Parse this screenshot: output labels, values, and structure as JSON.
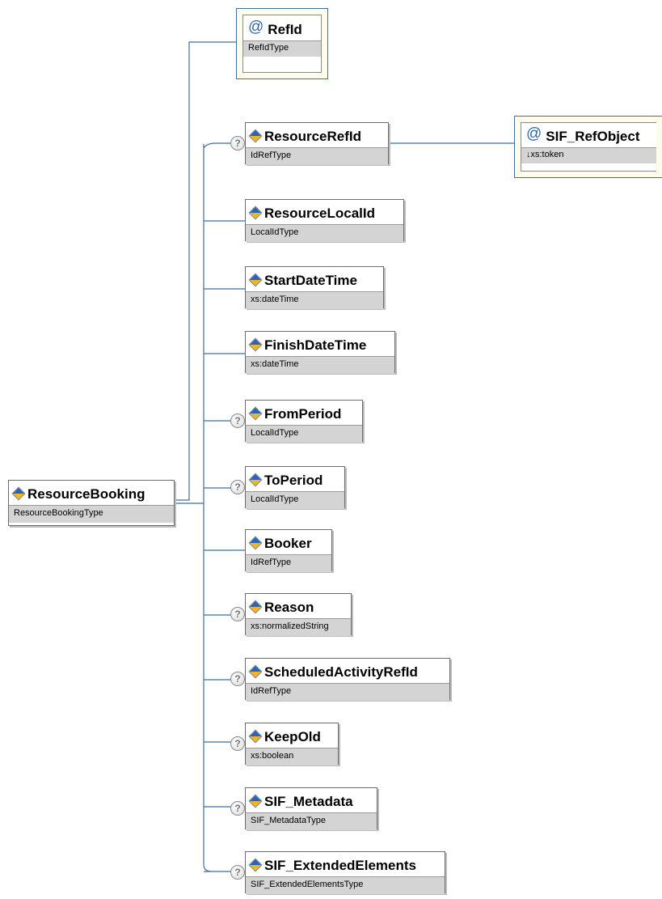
{
  "root": {
    "name": "ResourceBooking",
    "type": "ResourceBookingType"
  },
  "attributes": [
    {
      "name": "RefId",
      "type": "RefIdType"
    }
  ],
  "ref_object": {
    "name": "SIF_RefObject",
    "type": "↓xs:token"
  },
  "children": [
    {
      "name": "ResourceRefId",
      "type": "IdRefType",
      "optional": true
    },
    {
      "name": "ResourceLocalId",
      "type": "LocalIdType",
      "optional": false
    },
    {
      "name": "StartDateTime",
      "type": "xs:dateTime",
      "optional": false
    },
    {
      "name": "FinishDateTime",
      "type": "xs:dateTime",
      "optional": false
    },
    {
      "name": "FromPeriod",
      "type": "LocalIdType",
      "optional": true
    },
    {
      "name": "ToPeriod",
      "type": "LocalIdType",
      "optional": true
    },
    {
      "name": "Booker",
      "type": "IdRefType",
      "optional": false
    },
    {
      "name": "Reason",
      "type": "xs:normalizedString",
      "optional": true
    },
    {
      "name": "ScheduledActivityRefId",
      "type": "IdRefType",
      "optional": true
    },
    {
      "name": "KeepOld",
      "type": "xs:boolean",
      "optional": true
    },
    {
      "name": "SIF_Metadata",
      "type": "SIF_MetadataType",
      "optional": true
    },
    {
      "name": "SIF_ExtendedElements",
      "type": "SIF_ExtendedElementsType",
      "optional": true
    }
  ],
  "icons": {
    "element": "element-diamond-icon",
    "attribute": "attribute-at-icon",
    "optional": "optional-question-icon"
  },
  "colors": {
    "connector": "#3f6f9f",
    "attribute_border": "#3f6f9f",
    "attribute_background": "#fdfbea",
    "type_bar": "#d4d4d4"
  }
}
